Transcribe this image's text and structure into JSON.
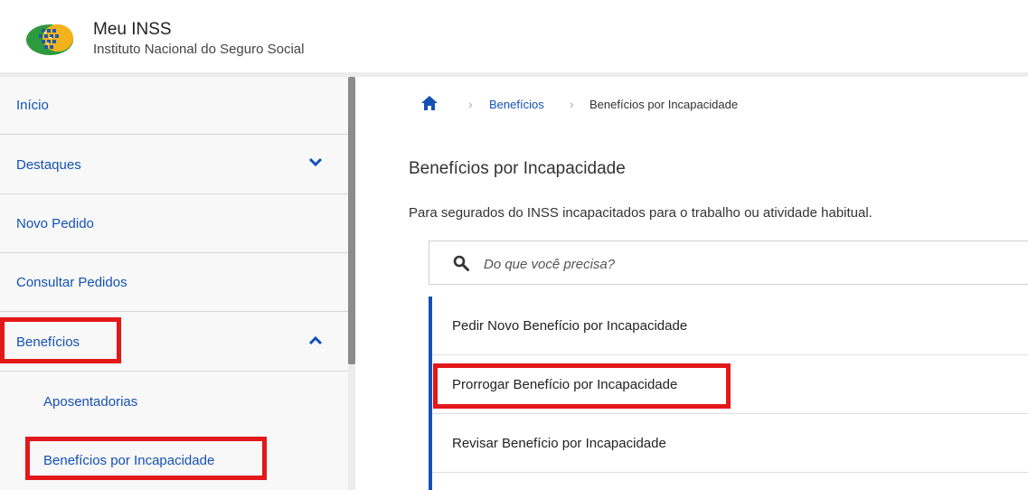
{
  "header": {
    "app_title": "Meu INSS",
    "app_subtitle": "Instituto Nacional do Seguro Social"
  },
  "sidebar": {
    "items": [
      {
        "label": "Início",
        "icon": null
      },
      {
        "label": "Destaques",
        "icon": "chevron-down-icon"
      },
      {
        "label": "Novo Pedido",
        "icon": null
      },
      {
        "label": "Consultar Pedidos",
        "icon": null
      },
      {
        "label": "Benefícios",
        "icon": "chevron-up-icon"
      }
    ],
    "sub_items": [
      {
        "label": "Aposentadorias"
      },
      {
        "label": "Benefícios por Incapacidade"
      }
    ]
  },
  "breadcrumb": {
    "home_icon": "home-icon",
    "link": "Benefícios",
    "current": "Benefícios por Incapacidade"
  },
  "main": {
    "title": "Benefícios por Incapacidade",
    "description": "Para segurados do INSS incapacitados para o trabalho ou atividade habitual.",
    "search": {
      "placeholder": "Do que você precisa?",
      "icon": "search-icon"
    },
    "services": [
      {
        "label": "Pedir Novo Benefício por Incapacidade"
      },
      {
        "label": "Prorrogar Benefício por Incapacidade"
      },
      {
        "label": "Revisar Benefício por Incapacidade"
      }
    ]
  },
  "colors": {
    "link_blue": "#1351b4",
    "highlight_red": "#e2181b",
    "sidebar_bg": "#f8f8f8"
  }
}
